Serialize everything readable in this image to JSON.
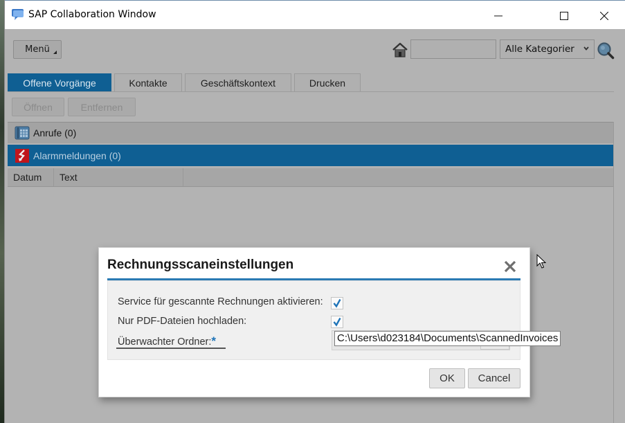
{
  "window": {
    "title": "SAP Collaboration Window",
    "icon": "chat-bubble-icon",
    "controls": [
      "minimize",
      "maximize",
      "close"
    ]
  },
  "toolbar": {
    "menu_label": "Menü",
    "search_value": "",
    "category_selected": "Alle Kategorien",
    "category_visible_text": "Alle Kategorier"
  },
  "tabs": [
    {
      "label": "Offene Vorgänge",
      "active": true
    },
    {
      "label": "Kontakte",
      "active": false
    },
    {
      "label": "Geschäftskontext",
      "active": false
    },
    {
      "label": "Drucken",
      "active": false
    }
  ],
  "actions": {
    "open_label": "Öffnen",
    "remove_label": "Entfernen"
  },
  "groups": [
    {
      "label": "Anrufe (0)",
      "icon": "phone-icon",
      "selected": false
    },
    {
      "label": "Alarmmeldungen (0)",
      "icon": "alarm-icon",
      "selected": true
    }
  ],
  "table": {
    "columns": [
      "Datum",
      "Text",
      ""
    ],
    "rows": []
  },
  "dialog": {
    "title": "Rechnungsscaneinstellungen",
    "fields": {
      "service_label": "Service für gescannte Rechnungen aktivieren:",
      "service_checked": true,
      "pdf_only_label": "Nur PDF-Dateien hochladen:",
      "pdf_only_checked": true,
      "folder_label": "Überwachter Ordner:",
      "folder_required_mark": "*",
      "folder_value": "C:\\Users\\d023184\\Documents\\ScannedInvoices"
    },
    "ok_label": "OK",
    "cancel_label": "Cancel"
  },
  "colors": {
    "accent": "#0f5f93",
    "dialog_rule": "#2a7ab3",
    "check": "#1f74b8",
    "alarm_icon": "#c0161c"
  }
}
